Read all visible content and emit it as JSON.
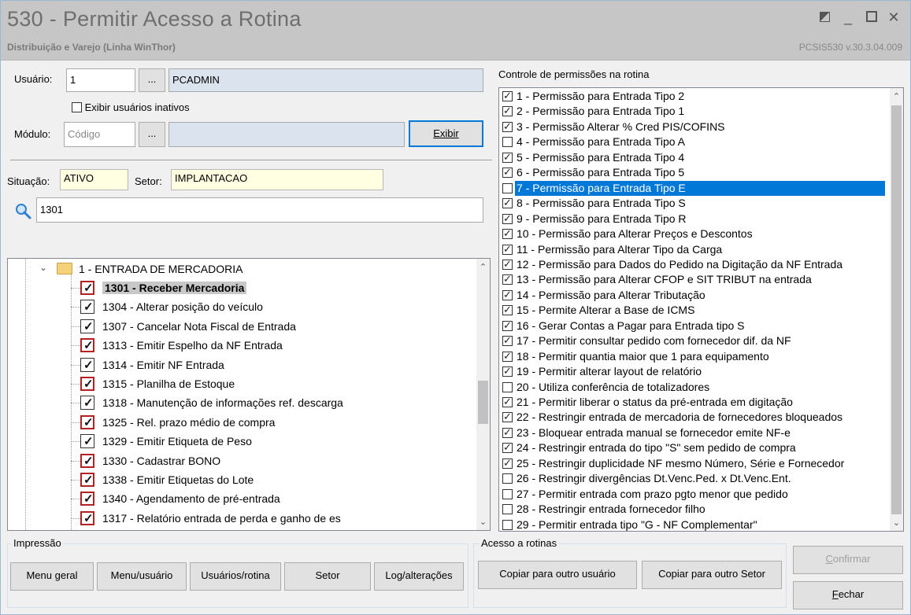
{
  "window": {
    "title": "530 - Permitir Acesso a Rotina",
    "subtitle": "Distribuição e Varejo (Linha WinThor)",
    "version": "PCSIS530  v.30.3.04.009"
  },
  "form": {
    "usuario_label": "Usuário:",
    "usuario_code": "1",
    "usuario_name": "PCADMIN",
    "ellipsis": "...",
    "inativos_label": "Exibir usuários inativos",
    "modulo_label": "Módulo:",
    "modulo_placeholder": "Código",
    "exibir_label": "Exibir",
    "situacao_label": "Situação:",
    "situacao_value": "ATIVO",
    "setor_label": "Setor:",
    "setor_value": "IMPLANTACAO",
    "search_value": "1301"
  },
  "tree": {
    "parent_label": "1 - ENTRADA DE MERCADORIA",
    "items": [
      {
        "label": "1301 - Receber Mercadoria",
        "style": "red"
      },
      {
        "label": "1304 - Alterar posição do veículo",
        "style": "black"
      },
      {
        "label": "1307 - Cancelar Nota Fiscal de  Entrada",
        "style": "black"
      },
      {
        "label": "1313 - Emitir Espelho da NF Entrada",
        "style": "red"
      },
      {
        "label": "1314 - Emitir NF Entrada",
        "style": "black"
      },
      {
        "label": "1315 - Planilha de Estoque",
        "style": "red"
      },
      {
        "label": "1318 - Manutenção de informações ref. descarga",
        "style": "black"
      },
      {
        "label": "1325 - Rel. prazo médio de compra",
        "style": "red"
      },
      {
        "label": "1329 - Emitir Etiqueta de Peso",
        "style": "black"
      },
      {
        "label": "1330 - Cadastrar BONO",
        "style": "red"
      },
      {
        "label": "1338 - Emitir Etiquetas do Lote",
        "style": "red"
      },
      {
        "label": "1340 - Agendamento de pré-entrada",
        "style": "red"
      },
      {
        "label": "1317 - Relatório entrada de perda e ganho de es",
        "style": "red"
      }
    ]
  },
  "permissions": {
    "header": "Controle de permissões na rotina",
    "items": [
      {
        "label": "1 - Permissão para Entrada Tipo 2",
        "checked": true
      },
      {
        "label": "2 - Permissão para Entrada Tipo 1",
        "checked": true
      },
      {
        "label": "3 - Permissão Alterar % Cred PIS/COFINS",
        "checked": true
      },
      {
        "label": "4 - Permissão para Entrada Tipo A",
        "checked": false
      },
      {
        "label": "5 - Permissão para Entrada Tipo 4",
        "checked": true
      },
      {
        "label": "6 - Permissão para Entrada Tipo 5",
        "checked": true
      },
      {
        "label": "7 - Permissão para Entrada Tipo E",
        "checked": false,
        "selected": true
      },
      {
        "label": "8 - Permissão para Entrada Tipo S",
        "checked": true
      },
      {
        "label": "9 - Permissão para Entrada Tipo R",
        "checked": true
      },
      {
        "label": "10 - Permissão para Alterar Preços e Descontos",
        "checked": true
      },
      {
        "label": "11 - Permissão para Alterar Tipo da Carga",
        "checked": true
      },
      {
        "label": "12 - Permissão para Dados do Pedido na Digitação da NF Entrada",
        "checked": true
      },
      {
        "label": "13 - Permissão para Alterar CFOP e SIT TRIBUT na entrada",
        "checked": true
      },
      {
        "label": "14 - Permissão para Alterar Tributação",
        "checked": true
      },
      {
        "label": "15 - Permite Alterar a Base de ICMS",
        "checked": true
      },
      {
        "label": "16 - Gerar Contas a Pagar para Entrada tipo S",
        "checked": true
      },
      {
        "label": "17 - Permitir consultar pedido com fornecedor dif. da NF",
        "checked": true
      },
      {
        "label": "18 - Permitir quantia maior que 1 para equipamento",
        "checked": true
      },
      {
        "label": "19 - Permitir alterar layout de relatório",
        "checked": true
      },
      {
        "label": "20 - Utiliza conferência de totalizadores",
        "checked": false
      },
      {
        "label": "21 - Permitir liberar o status da pré-entrada em digitação",
        "checked": true
      },
      {
        "label": "22 - Restringir entrada de mercadoria de fornecedores bloqueados",
        "checked": true
      },
      {
        "label": "23 - Bloquear entrada manual se fornecedor emite NF-e",
        "checked": true
      },
      {
        "label": "24 - Restringir entrada do tipo \"S\" sem pedido de compra",
        "checked": true
      },
      {
        "label": "25 - Restringir duplicidade NF mesmo Número, Série e Fornecedor",
        "checked": true
      },
      {
        "label": "26 - Restringir divergências Dt.Venc.Ped. x Dt.Venc.Ent.",
        "checked": false
      },
      {
        "label": "27 - Permitir entrada com prazo pgto menor que pedido",
        "checked": false
      },
      {
        "label": "28 - Restringir entrada fornecedor filho",
        "checked": false
      },
      {
        "label": "29 - Permitir entrada tipo \"G - NF Complementar\"",
        "checked": false
      }
    ]
  },
  "impressao": {
    "title": "Impressão",
    "menu_geral": "Menu geral",
    "menu_usuario": "Menu/usuário",
    "usuarios_rotina": "Usuários/rotina",
    "setor": "Setor",
    "log": "Log/alterações"
  },
  "acesso": {
    "title": "Acesso a rotinas",
    "copiar_usuario": "Copiar para outro usuário",
    "copiar_setor": "Copiar para outro Setor"
  },
  "actions": {
    "confirmar": "Confirmar",
    "fechar": "Fechar"
  }
}
